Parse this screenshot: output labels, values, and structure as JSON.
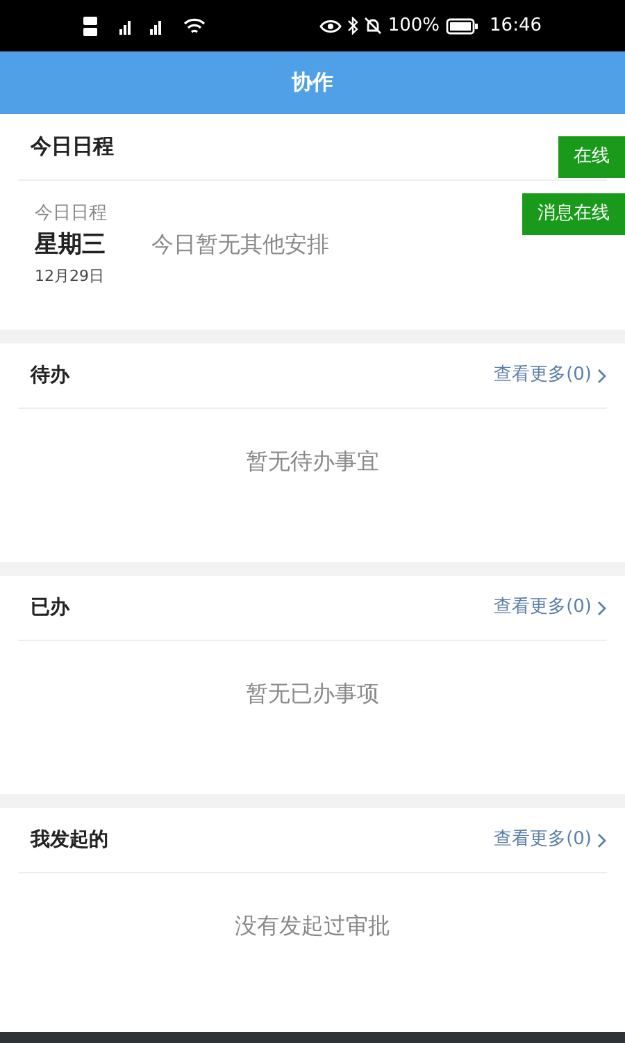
{
  "status_bar": {
    "battery": "100%",
    "time": "16:46"
  },
  "header": {
    "title": "协作"
  },
  "schedule": {
    "title": "今日日程",
    "badges": [
      "在线",
      "消息在线"
    ],
    "label": "今日日程",
    "weekday": "星期三",
    "date": "12月29日",
    "empty": "今日暂无其他安排"
  },
  "sections": [
    {
      "title": "待办",
      "more": "查看更多(0)",
      "empty": "暂无待办事宜"
    },
    {
      "title": "已办",
      "more": "查看更多(0)",
      "empty": "暂无已办事项"
    },
    {
      "title": "我发起的",
      "more": "查看更多(0)",
      "empty": "没有发起过审批"
    }
  ]
}
